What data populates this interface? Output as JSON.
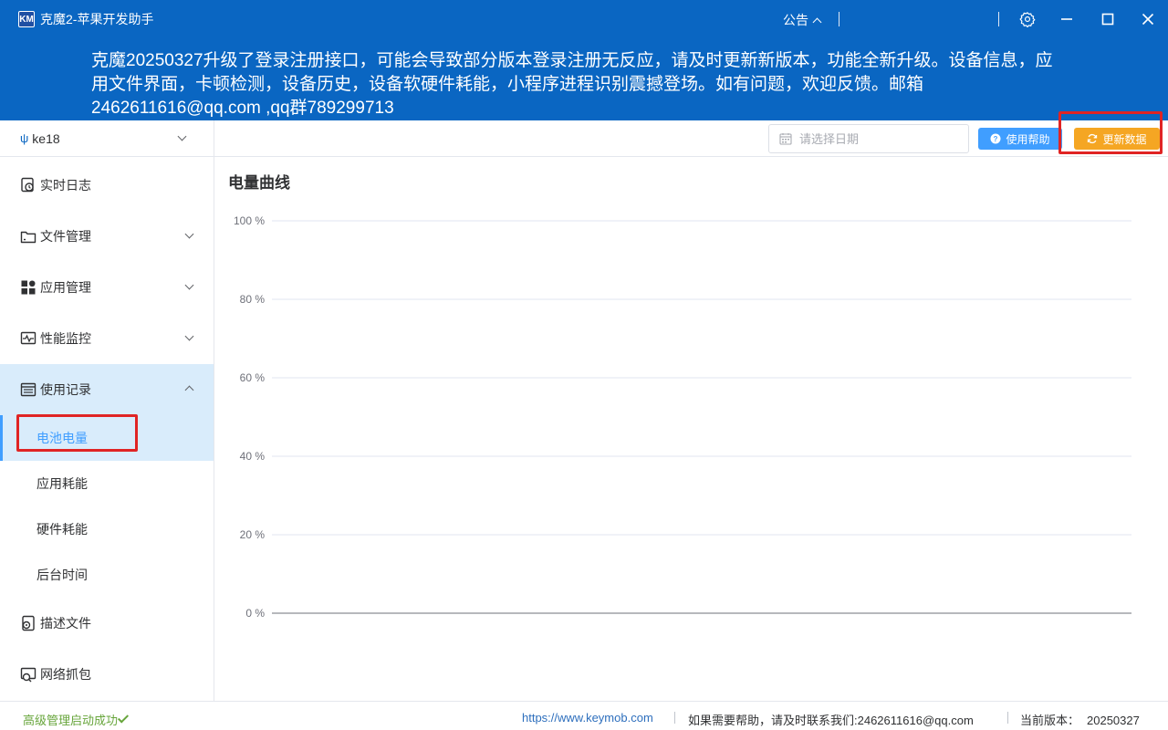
{
  "window": {
    "logo_text": "KM",
    "title": "克魔2-苹果开发助手",
    "notice_label": "公告",
    "settings_icon": "gear-icon",
    "minimize_icon": "minimize-icon",
    "maximize_icon": "maximize-icon",
    "close_icon": "close-icon"
  },
  "banner": {
    "text": "克魔20250327升级了登录注册接口，可能会导致部分版本登录注册无反应，请及时更新新版本，功能全新升级。设备信息，应用文件界面，卡顿检测，设备历史，设备软硬件耗能，小程序进程识别震撼登场。如有问题，欢迎反馈。邮箱2462611616@qq.com ,qq群789299713"
  },
  "sidebar": {
    "device": {
      "icon": "usb-icon",
      "name": "ke18"
    },
    "items": [
      {
        "label": "实时日志",
        "icon": "log-icon"
      },
      {
        "label": "文件管理",
        "icon": "folder-icon"
      },
      {
        "label": "应用管理",
        "icon": "apps-icon"
      },
      {
        "label": "性能监控",
        "icon": "monitor-icon"
      },
      {
        "label": "使用记录",
        "icon": "record-icon"
      },
      {
        "label": "描述文件",
        "icon": "profile-icon"
      },
      {
        "label": "网络抓包",
        "icon": "network-icon"
      }
    ],
    "sub_items": [
      {
        "label": "电池电量"
      },
      {
        "label": "应用耗能"
      },
      {
        "label": "硬件耗能"
      },
      {
        "label": "后台时间"
      }
    ]
  },
  "toolbar": {
    "date_placeholder": "请选择日期",
    "help_label": "使用帮助",
    "update_label": "更新数据",
    "accent": "#409eff",
    "update_color": "#f5a623"
  },
  "main": {
    "title": "电量曲线"
  },
  "chart_data": {
    "type": "line",
    "title": "电量曲线",
    "xlabel": "",
    "ylabel": "",
    "y_ticks": [
      "100 %",
      "80 %",
      "60 %",
      "40 %",
      "20 %",
      "0 %"
    ],
    "ylim": [
      0,
      100
    ],
    "grid": true,
    "series": []
  },
  "status": {
    "ok_text": "高级管理启动成功",
    "link": "https://www.keymob.com",
    "help_text": "如果需要帮助，请及时联系我们:2462611616@qq.com",
    "version_label": "当前版本：",
    "version_value": "20250327"
  }
}
